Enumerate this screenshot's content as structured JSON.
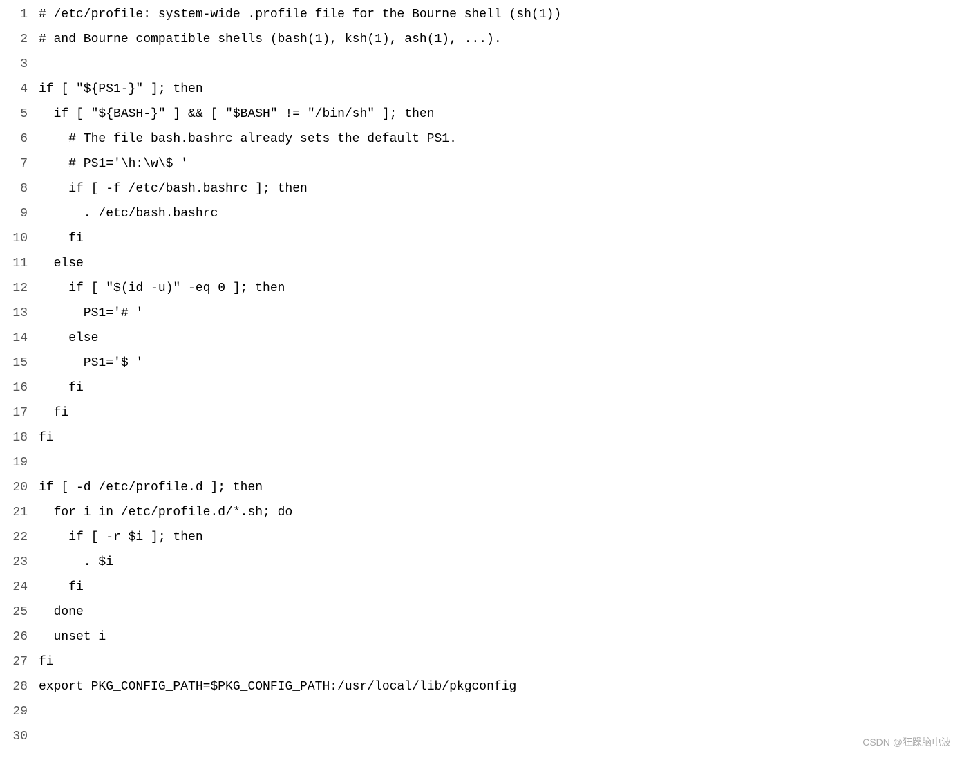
{
  "lines": [
    {
      "number": 1,
      "content": "# /etc/profile: system-wide .profile file for the Bourne shell (sh(1))"
    },
    {
      "number": 2,
      "content": "# and Bourne compatible shells (bash(1), ksh(1), ash(1), ...)."
    },
    {
      "number": 3,
      "content": ""
    },
    {
      "number": 4,
      "content": "if [ \"${PS1-}\" ]; then"
    },
    {
      "number": 5,
      "content": "  if [ \"${BASH-}\" ] && [ \"$BASH\" != \"/bin/sh\" ]; then"
    },
    {
      "number": 6,
      "content": "    # The file bash.bashrc already sets the default PS1."
    },
    {
      "number": 7,
      "content": "    # PS1='\\h:\\w\\$ '"
    },
    {
      "number": 8,
      "content": "    if [ -f /etc/bash.bashrc ]; then"
    },
    {
      "number": 9,
      "content": "      . /etc/bash.bashrc"
    },
    {
      "number": 10,
      "content": "    fi"
    },
    {
      "number": 11,
      "content": "  else"
    },
    {
      "number": 12,
      "content": "    if [ \"$(id -u)\" -eq 0 ]; then"
    },
    {
      "number": 13,
      "content": "      PS1='# '"
    },
    {
      "number": 14,
      "content": "    else"
    },
    {
      "number": 15,
      "content": "      PS1='$ '"
    },
    {
      "number": 16,
      "content": "    fi"
    },
    {
      "number": 17,
      "content": "  fi"
    },
    {
      "number": 18,
      "content": "fi"
    },
    {
      "number": 19,
      "content": ""
    },
    {
      "number": 20,
      "content": "if [ -d /etc/profile.d ]; then"
    },
    {
      "number": 21,
      "content": "  for i in /etc/profile.d/*.sh; do"
    },
    {
      "number": 22,
      "content": "    if [ -r $i ]; then"
    },
    {
      "number": 23,
      "content": "      . $i"
    },
    {
      "number": 24,
      "content": "    fi"
    },
    {
      "number": 25,
      "content": "  done"
    },
    {
      "number": 26,
      "content": "  unset i"
    },
    {
      "number": 27,
      "content": "fi"
    },
    {
      "number": 28,
      "content": "export PKG_CONFIG_PATH=$PKG_CONFIG_PATH:/usr/local/lib/pkgconfig"
    },
    {
      "number": 29,
      "content": ""
    },
    {
      "number": 30,
      "content": ""
    }
  ],
  "watermark": "CSDN @狂躁脑电波"
}
